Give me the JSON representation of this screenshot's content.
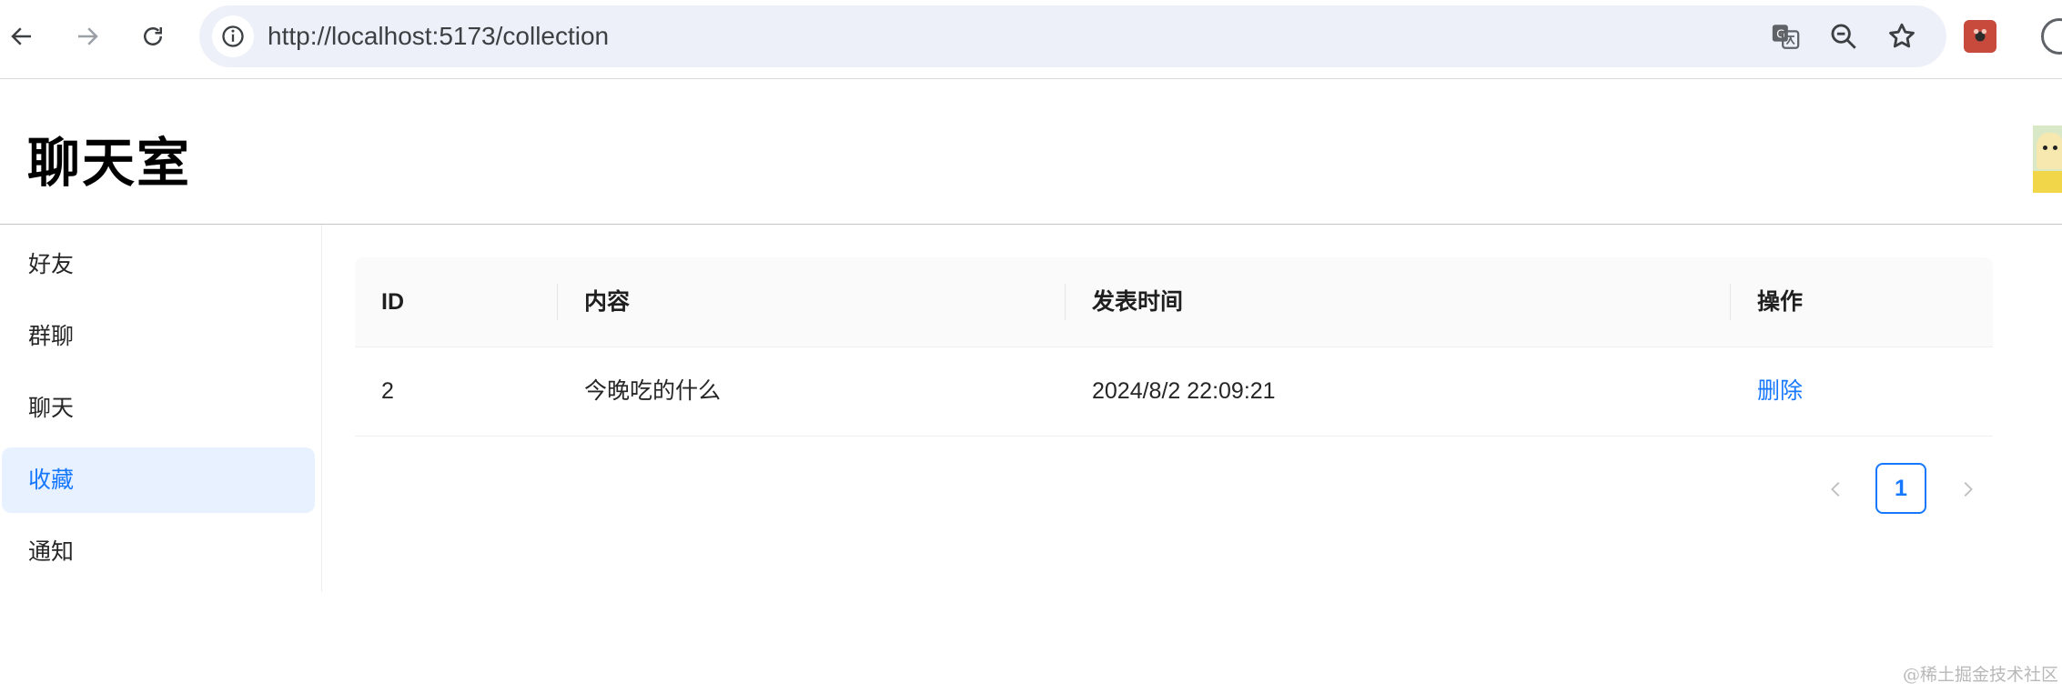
{
  "browser": {
    "url": "http://localhost:5173/collection",
    "icons": [
      "back-icon",
      "forward-icon",
      "reload-icon",
      "site-info-icon",
      "translate-icon",
      "zoom-out-icon",
      "star-icon",
      "extension-icon",
      "profile-icon"
    ]
  },
  "app": {
    "title": "聊天室"
  },
  "sidebar": {
    "items": [
      {
        "label": "好友",
        "active": false
      },
      {
        "label": "群聊",
        "active": false
      },
      {
        "label": "聊天",
        "active": false
      },
      {
        "label": "收藏",
        "active": true
      },
      {
        "label": "通知",
        "active": false
      }
    ]
  },
  "table": {
    "columns": [
      "ID",
      "内容",
      "发表时间",
      "操作"
    ],
    "rows": [
      {
        "id": "2",
        "content": "今晚吃的什么",
        "time": "2024/8/2 22:09:21",
        "action": "删除"
      }
    ]
  },
  "pagination": {
    "current_page": "1"
  },
  "watermark": "@稀土掘金技术社区",
  "colors": {
    "accent": "#1677ff",
    "active_bg": "#e7f1ff",
    "omnibox_bg": "#edf0f8"
  }
}
